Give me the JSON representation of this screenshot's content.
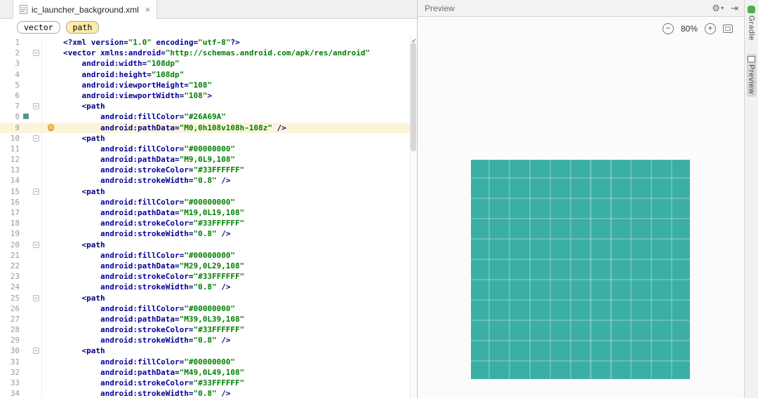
{
  "tab": {
    "title": "ic_launcher_background.xml",
    "close": "×"
  },
  "breadcrumbs": [
    {
      "label": "vector"
    },
    {
      "label": "path"
    }
  ],
  "editor": {
    "current_line": 9,
    "fold_lines": [
      2,
      7,
      10,
      15,
      20,
      25,
      30
    ],
    "fold_glyph": "−",
    "swatch_line": 8,
    "swatch_color": "#26A69A",
    "bulb_line": 9,
    "inspection_icon": "✔",
    "lines": [
      {
        "n": 1,
        "seg": [
          [
            "t",
            "<?xml "
          ],
          [
            "a",
            "version"
          ],
          [
            "t",
            "="
          ],
          [
            "s",
            "\"1.0\""
          ],
          [
            "t",
            " "
          ],
          [
            "a",
            "encoding"
          ],
          [
            "t",
            "="
          ],
          [
            "s",
            "\"utf-8\""
          ],
          [
            "t",
            "?>"
          ]
        ]
      },
      {
        "n": 2,
        "seg": [
          [
            "t",
            "<vector "
          ],
          [
            "a",
            "xmlns:android"
          ],
          [
            "t",
            "="
          ],
          [
            "s",
            "\"http://schemas.android.com/apk/res/android\""
          ]
        ]
      },
      {
        "n": 3,
        "seg": [
          [
            "p",
            "    "
          ],
          [
            "a",
            "android:width"
          ],
          [
            "t",
            "="
          ],
          [
            "s",
            "\"108dp\""
          ]
        ]
      },
      {
        "n": 4,
        "seg": [
          [
            "p",
            "    "
          ],
          [
            "a",
            "android:height"
          ],
          [
            "t",
            "="
          ],
          [
            "s",
            "\"108dp\""
          ]
        ]
      },
      {
        "n": 5,
        "seg": [
          [
            "p",
            "    "
          ],
          [
            "a",
            "android:viewportHeight"
          ],
          [
            "t",
            "="
          ],
          [
            "s",
            "\"108\""
          ]
        ]
      },
      {
        "n": 6,
        "seg": [
          [
            "p",
            "    "
          ],
          [
            "a",
            "android:viewportWidth"
          ],
          [
            "t",
            "="
          ],
          [
            "s",
            "\"108\""
          ],
          [
            "t",
            ">"
          ]
        ]
      },
      {
        "n": 7,
        "seg": [
          [
            "p",
            "    "
          ],
          [
            "t",
            "<path"
          ]
        ]
      },
      {
        "n": 8,
        "seg": [
          [
            "p",
            "        "
          ],
          [
            "a",
            "android:fillColor"
          ],
          [
            "t",
            "="
          ],
          [
            "s",
            "\"#26A69A\""
          ]
        ]
      },
      {
        "n": 9,
        "seg": [
          [
            "p",
            "        "
          ],
          [
            "a",
            "android:pathData"
          ],
          [
            "t",
            "="
          ],
          [
            "s",
            "\"M0,0h108v108h-108z\""
          ],
          [
            "t",
            " />"
          ]
        ]
      },
      {
        "n": 10,
        "seg": [
          [
            "p",
            "    "
          ],
          [
            "t",
            "<path"
          ]
        ]
      },
      {
        "n": 11,
        "seg": [
          [
            "p",
            "        "
          ],
          [
            "a",
            "android:fillColor"
          ],
          [
            "t",
            "="
          ],
          [
            "s",
            "\"#00000000\""
          ]
        ]
      },
      {
        "n": 12,
        "seg": [
          [
            "p",
            "        "
          ],
          [
            "a",
            "android:pathData"
          ],
          [
            "t",
            "="
          ],
          [
            "s",
            "\"M9,0L9,108\""
          ]
        ]
      },
      {
        "n": 13,
        "seg": [
          [
            "p",
            "        "
          ],
          [
            "a",
            "android:strokeColor"
          ],
          [
            "t",
            "="
          ],
          [
            "s",
            "\"#33FFFFFF\""
          ]
        ]
      },
      {
        "n": 14,
        "seg": [
          [
            "p",
            "        "
          ],
          [
            "a",
            "android:strokeWidth"
          ],
          [
            "t",
            "="
          ],
          [
            "s",
            "\"0.8\""
          ],
          [
            "t",
            " />"
          ]
        ]
      },
      {
        "n": 15,
        "seg": [
          [
            "p",
            "    "
          ],
          [
            "t",
            "<path"
          ]
        ]
      },
      {
        "n": 16,
        "seg": [
          [
            "p",
            "        "
          ],
          [
            "a",
            "android:fillColor"
          ],
          [
            "t",
            "="
          ],
          [
            "s",
            "\"#00000000\""
          ]
        ]
      },
      {
        "n": 17,
        "seg": [
          [
            "p",
            "        "
          ],
          [
            "a",
            "android:pathData"
          ],
          [
            "t",
            "="
          ],
          [
            "s",
            "\"M19,0L19,108\""
          ]
        ]
      },
      {
        "n": 18,
        "seg": [
          [
            "p",
            "        "
          ],
          [
            "a",
            "android:strokeColor"
          ],
          [
            "t",
            "="
          ],
          [
            "s",
            "\"#33FFFFFF\""
          ]
        ]
      },
      {
        "n": 19,
        "seg": [
          [
            "p",
            "        "
          ],
          [
            "a",
            "android:strokeWidth"
          ],
          [
            "t",
            "="
          ],
          [
            "s",
            "\"0.8\""
          ],
          [
            "t",
            " />"
          ]
        ]
      },
      {
        "n": 20,
        "seg": [
          [
            "p",
            "    "
          ],
          [
            "t",
            "<path"
          ]
        ]
      },
      {
        "n": 21,
        "seg": [
          [
            "p",
            "        "
          ],
          [
            "a",
            "android:fillColor"
          ],
          [
            "t",
            "="
          ],
          [
            "s",
            "\"#00000000\""
          ]
        ]
      },
      {
        "n": 22,
        "seg": [
          [
            "p",
            "        "
          ],
          [
            "a",
            "android:pathData"
          ],
          [
            "t",
            "="
          ],
          [
            "s",
            "\"M29,0L29,108\""
          ]
        ]
      },
      {
        "n": 23,
        "seg": [
          [
            "p",
            "        "
          ],
          [
            "a",
            "android:strokeColor"
          ],
          [
            "t",
            "="
          ],
          [
            "s",
            "\"#33FFFFFF\""
          ]
        ]
      },
      {
        "n": 24,
        "seg": [
          [
            "p",
            "        "
          ],
          [
            "a",
            "android:strokeWidth"
          ],
          [
            "t",
            "="
          ],
          [
            "s",
            "\"0.8\""
          ],
          [
            "t",
            " />"
          ]
        ]
      },
      {
        "n": 25,
        "seg": [
          [
            "p",
            "    "
          ],
          [
            "t",
            "<path"
          ]
        ]
      },
      {
        "n": 26,
        "seg": [
          [
            "p",
            "        "
          ],
          [
            "a",
            "android:fillColor"
          ],
          [
            "t",
            "="
          ],
          [
            "s",
            "\"#00000000\""
          ]
        ]
      },
      {
        "n": 27,
        "seg": [
          [
            "p",
            "        "
          ],
          [
            "a",
            "android:pathData"
          ],
          [
            "t",
            "="
          ],
          [
            "s",
            "\"M39,0L39,108\""
          ]
        ]
      },
      {
        "n": 28,
        "seg": [
          [
            "p",
            "        "
          ],
          [
            "a",
            "android:strokeColor"
          ],
          [
            "t",
            "="
          ],
          [
            "s",
            "\"#33FFFFFF\""
          ]
        ]
      },
      {
        "n": 29,
        "seg": [
          [
            "p",
            "        "
          ],
          [
            "a",
            "android:strokeWidth"
          ],
          [
            "t",
            "="
          ],
          [
            "s",
            "\"0.8\""
          ],
          [
            "t",
            " />"
          ]
        ]
      },
      {
        "n": 30,
        "seg": [
          [
            "p",
            "    "
          ],
          [
            "t",
            "<path"
          ]
        ]
      },
      {
        "n": 31,
        "seg": [
          [
            "p",
            "        "
          ],
          [
            "a",
            "android:fillColor"
          ],
          [
            "t",
            "="
          ],
          [
            "s",
            "\"#00000000\""
          ]
        ]
      },
      {
        "n": 32,
        "seg": [
          [
            "p",
            "        "
          ],
          [
            "a",
            "android:pathData"
          ],
          [
            "t",
            "="
          ],
          [
            "s",
            "\"M49,0L49,108\""
          ]
        ]
      },
      {
        "n": 33,
        "seg": [
          [
            "p",
            "        "
          ],
          [
            "a",
            "android:strokeColor"
          ],
          [
            "t",
            "="
          ],
          [
            "s",
            "\"#33FFFFFF\""
          ]
        ]
      },
      {
        "n": 34,
        "seg": [
          [
            "p",
            "        "
          ],
          [
            "a",
            "android:strokeWidth"
          ],
          [
            "t",
            "="
          ],
          [
            "s",
            "\"0.8\""
          ],
          [
            "t",
            " />"
          ]
        ]
      }
    ]
  },
  "preview": {
    "title": "Preview",
    "zoom_out": "−",
    "zoom_level": "80%",
    "zoom_in": "+",
    "fill_color": "#26A69A",
    "grid_color": "rgba(255,255,255,0.22)",
    "grid_stroke_hex": "#33FFFFFF",
    "grid_positions": [
      9,
      19,
      29,
      39,
      49,
      59,
      69,
      79,
      89,
      99
    ],
    "viewport": 108
  },
  "header_icons": {
    "gear": "⚙",
    "arrow": "▾",
    "hide": "⇥"
  },
  "stripe": {
    "items": [
      {
        "label": "Gradle"
      },
      {
        "label": "Preview"
      }
    ]
  }
}
